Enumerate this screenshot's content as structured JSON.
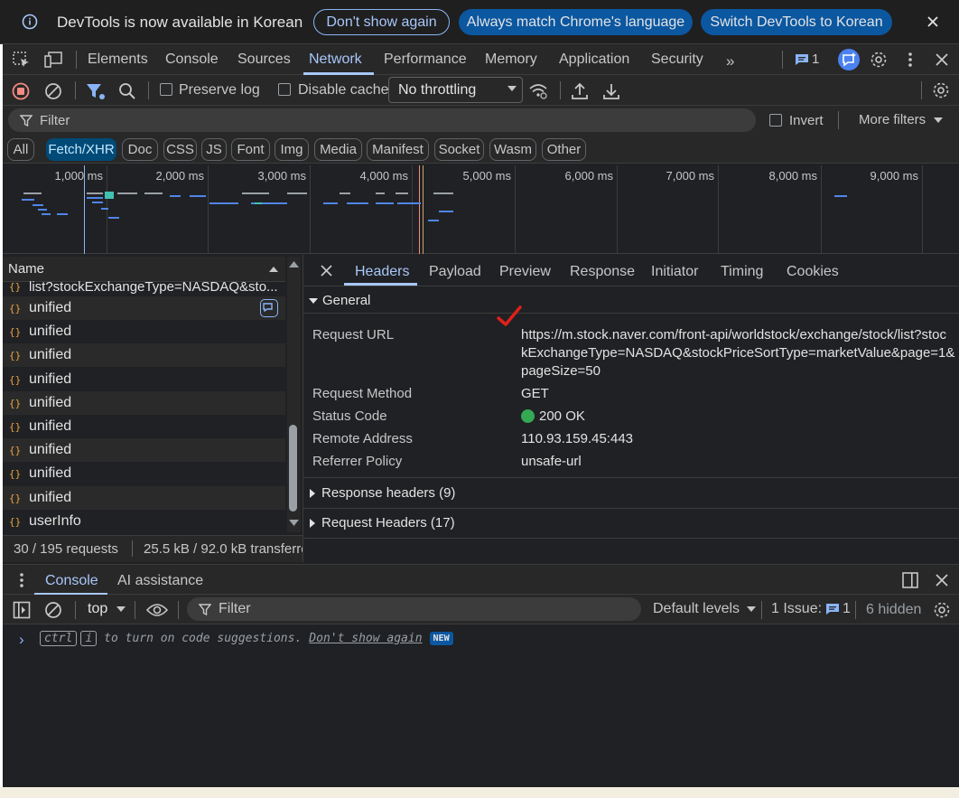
{
  "infobar": {
    "message": "DevTools is now available in Korean",
    "btn_dont_show": "Don't show again",
    "btn_match": "Always match Chrome's language",
    "btn_switch": "Switch DevTools to Korean"
  },
  "main_tabs": [
    "Elements",
    "Console",
    "Sources",
    "Network",
    "Performance",
    "Memory",
    "Application",
    "Security"
  ],
  "issues_count": "1",
  "toolbar": {
    "preserve_log": "Preserve log",
    "disable_cache": "Disable cache",
    "throttling": "No throttling"
  },
  "filter": {
    "placeholder": "Filter",
    "invert": "Invert",
    "more_filters": "More filters"
  },
  "type_filters": [
    "All",
    "Fetch/XHR",
    "Doc",
    "CSS",
    "JS",
    "Font",
    "Img",
    "Media",
    "Manifest",
    "Socket",
    "Wasm",
    "Other"
  ],
  "timeline_ticks": [
    "1,000 ms",
    "2,000 ms",
    "3,000 ms",
    "4,000 ms",
    "5,000 ms",
    "6,000 ms",
    "7,000 ms",
    "8,000 ms",
    "9,000 ms"
  ],
  "request_list": {
    "header": "Name",
    "partial_top": "list?stockExchangeType=NASDAQ&sto...",
    "items": [
      "unified",
      "unified",
      "unified",
      "unified",
      "unified",
      "unified",
      "unified",
      "unified",
      "unified",
      "userInfo"
    ]
  },
  "status": {
    "requests": "30 / 195 requests",
    "transferred": "25.5 kB / 92.0 kB transferred"
  },
  "detail_tabs": [
    "Headers",
    "Payload",
    "Preview",
    "Response",
    "Initiator",
    "Timing",
    "Cookies"
  ],
  "general": {
    "title": "General",
    "request_url_label": "Request URL",
    "request_url_line1": "https://m.stock.naver.com/front-api/worldstock/exchange/stock/list?stoc",
    "request_url_line2": "kExchangeType=NASDAQ&stockPriceSortType=marketValue&page=1&",
    "request_url_line3": "pageSize=50",
    "method_label": "Request Method",
    "method_value": "GET",
    "status_label": "Status Code",
    "status_value": "200 OK",
    "remote_label": "Remote Address",
    "remote_value": "110.93.159.45:443",
    "referrer_label": "Referrer Policy",
    "referrer_value": "unsafe-url"
  },
  "response_headers": "Response headers (9)",
  "request_headers": "Request Headers (17)",
  "drawer": {
    "tab_console": "Console",
    "tab_ai": "AI assistance",
    "context": "top",
    "filter_placeholder": "Filter",
    "levels": "Default levels",
    "issues_label": "1 Issue:",
    "issues_count": "1",
    "hidden": "6 hidden"
  },
  "console_hint": {
    "key1": "ctrl",
    "key2": "i",
    "text": "to turn on code suggestions.",
    "link": "Don't show again",
    "badge": "NEW"
  },
  "colors": {
    "accent": "#a8c7fa",
    "status_ok": "#34a853",
    "record": "#f28b82"
  }
}
